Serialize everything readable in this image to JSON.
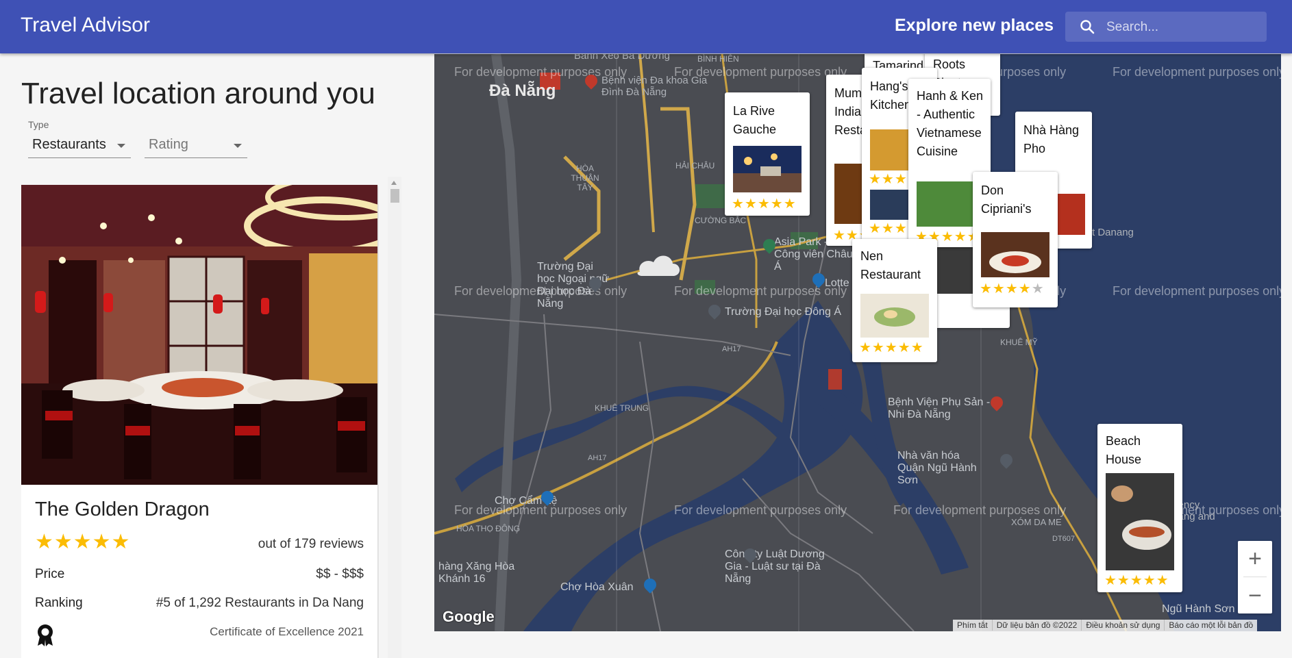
{
  "app": {
    "title": "Travel Advisor"
  },
  "header": {
    "explore": "Explore new places",
    "search_placeholder": "Search...",
    "search_icon": "search-icon"
  },
  "left": {
    "heading": "Travel location around you",
    "filters": {
      "type_label": "Type",
      "type_value": "Restaurants",
      "rating_placeholder": "Rating"
    }
  },
  "place_card": {
    "name": "The Golden Dragon",
    "stars": "★★★★★",
    "rating": 5,
    "reviews": "out of 179 reviews",
    "price_label": "Price",
    "price_value": "$$ - $$$",
    "ranking_label": "Ranking",
    "ranking_value": "#5 of 1,292 Restaurants in Da Nang",
    "award_icon": "award-icon",
    "award_text": "Certificate of Excellence 2021"
  },
  "map": {
    "watermark": "For development purposes only",
    "labels": {
      "danang": "Đà Nẵng",
      "banhxeo": "Bánh Xèo Bà Dưỡng",
      "binhhien": "BÌNH HIÊN",
      "benhvien": "Bệnh viện Đa khoa Gia Đình Đà Nẵng",
      "hoathuantay": "HÒA THUẬN TÂY",
      "haichau": "HẢI CHÂU",
      "cuongbac": "CƯỜNG BẮC",
      "asiapark": "Asia Park - Công viên Châu Á",
      "lottemart": "Lotte Mart",
      "truongngoaingu": "Trường Đại học Ngoại ngữ Đại học Đà Nẵng",
      "truongdonga": "Trường Đại học Đông Á",
      "khuetrung": "KHUÊ TRUNG",
      "khuemy": "KHUÊ MỸ",
      "bvphusan": "Bệnh Viện Phụ Sản - Nhi Đà Nẵng",
      "nhavanhoa": "Nhà văn hóa Quận Ngũ Hành Sơn",
      "chocamle": "Chợ Cẩm Lệ",
      "hoathodong": "HÒA THỌ ĐÔNG",
      "xomdame": "XÓM DA ME",
      "congtyluat": "Công ty Luật Dương Gia - Luật sư tại Đà Nẵng",
      "chohoaxuan": "Chợ Hòa Xuân",
      "nguhanhson": "Ngũ Hành Sơn",
      "cayxang": "hàng Xăng Hòa Khánh 16",
      "resort": "Resort Danang",
      "regency": "Regency Danang and Spa",
      "ah17": "AH17",
      "dt607": "DT607"
    },
    "pins": [
      {
        "name": "La Rive Gauche",
        "rating": 5
      },
      {
        "name": "Mumtaz Indian Restaurant",
        "rating": 5
      },
      {
        "name": "Tamarind",
        "rating": 5
      },
      {
        "name": "Hang's Kitchen",
        "rating": 5
      },
      {
        "name": "Roots Plant-based Cafe",
        "rating": 5
      },
      {
        "name": "Hanh & Ken - Authentic Vietnamese Cuisine",
        "rating": 5
      },
      {
        "name": "Nhà Hàng Pho",
        "rating": 5
      },
      {
        "name": "Don Cipriani's",
        "rating": 4
      },
      {
        "name": "Nen Restaurant",
        "rating": 5
      },
      {
        "name": "Beach House",
        "rating": 5
      }
    ],
    "zoom_in": "+",
    "zoom_out": "−",
    "google": "Google",
    "attribution": [
      "Phím tắt",
      "Dữ liệu bản đồ ©2022",
      "Điều khoản sử dụng",
      "Báo cáo một lỗi bản đồ"
    ]
  },
  "colors": {
    "appbar": "#3f51b5",
    "star": "#fbbc04",
    "map_land": "#4a4c52",
    "map_water": "#2c3e66",
    "map_road": "#c8a040"
  }
}
